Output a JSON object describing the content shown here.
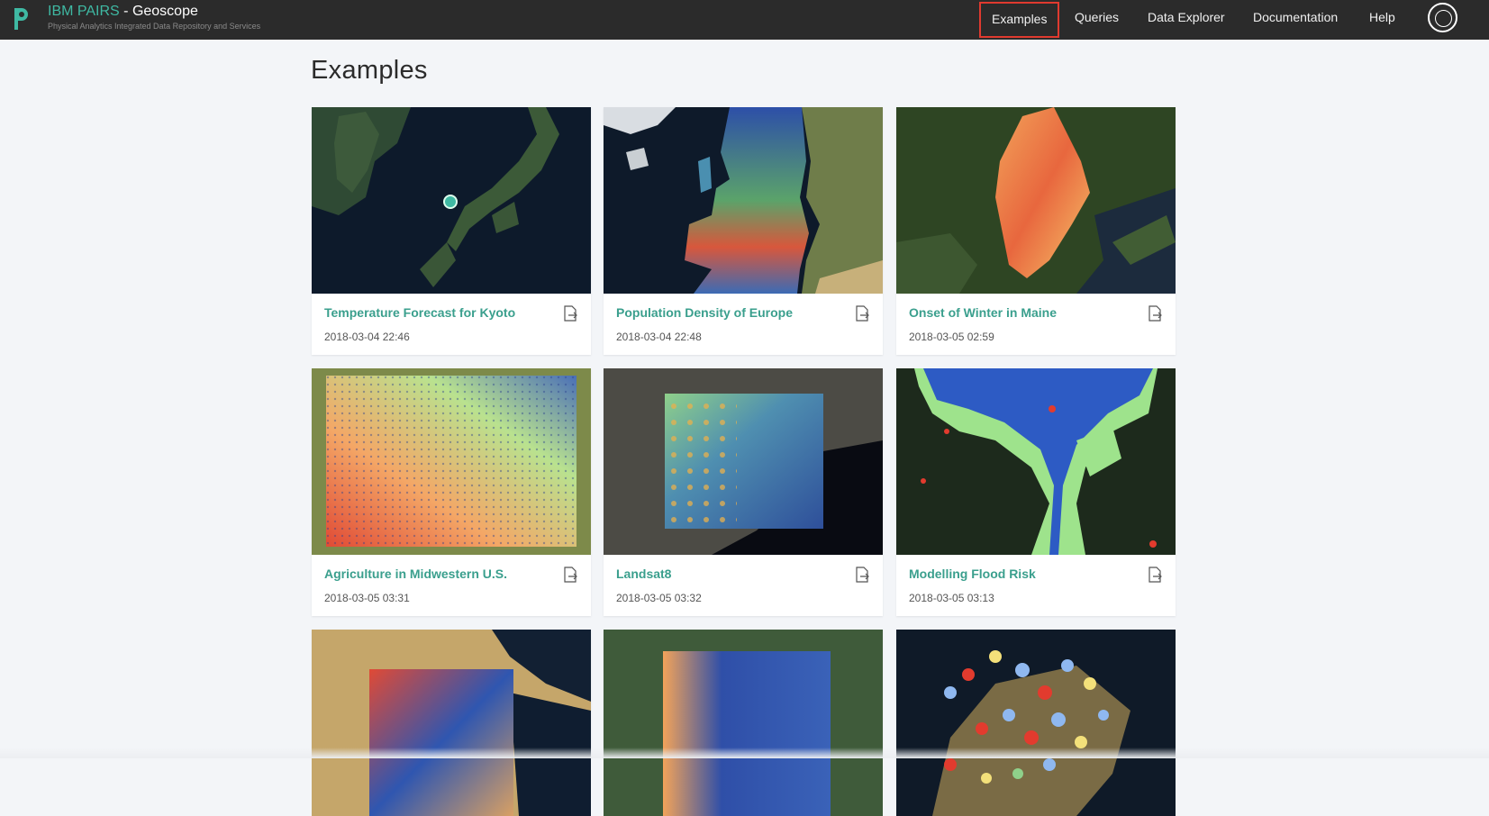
{
  "header": {
    "brand_accent": "IBM PAIRS",
    "brand_rest": " - Geoscope",
    "subtitle": "Physical Analytics Integrated Data Repository and Services",
    "logo_icon": "pairs-logo-icon",
    "accent_color": "#3fb9a3"
  },
  "nav": {
    "items": [
      {
        "label": "Examples",
        "active": true
      },
      {
        "label": "Queries"
      },
      {
        "label": "Data Explorer"
      },
      {
        "label": "Documentation"
      },
      {
        "label": "Help"
      }
    ],
    "user_icon": "user-avatar-icon"
  },
  "main": {
    "title": "Examples",
    "cards": [
      {
        "title": "Temperature Forecast for Kyoto",
        "date": "2018-03-04 22:46",
        "icon": "export-icon"
      },
      {
        "title": "Population Density of Europe",
        "date": "2018-03-04 22:48",
        "icon": "export-icon"
      },
      {
        "title": "Onset of Winter in Maine",
        "date": "2018-03-05 02:59",
        "icon": "export-icon"
      },
      {
        "title": "Agriculture in Midwestern U.S.",
        "date": "2018-03-05 03:31",
        "icon": "export-icon"
      },
      {
        "title": "Landsat8",
        "date": "2018-03-05 03:32",
        "icon": "export-icon"
      },
      {
        "title": "Modelling Flood Risk",
        "date": "2018-03-05 03:13",
        "icon": "export-icon"
      },
      {
        "title": "",
        "date": "",
        "icon": "export-icon"
      },
      {
        "title": "",
        "date": "",
        "icon": "export-icon"
      },
      {
        "title": "",
        "date": "",
        "icon": "export-icon"
      }
    ]
  }
}
